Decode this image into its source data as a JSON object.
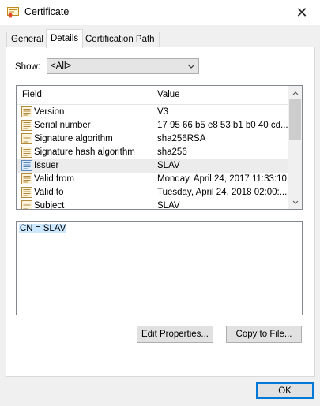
{
  "window": {
    "title": "Certificate",
    "close_glyph": "✕"
  },
  "tabs": [
    {
      "label": "General"
    },
    {
      "label": "Details"
    },
    {
      "label": "Certification Path"
    }
  ],
  "show": {
    "label": "Show:",
    "selected": "<All>"
  },
  "list": {
    "columns": [
      "Field",
      "Value"
    ],
    "rows": [
      {
        "field": "Version",
        "value": "V3"
      },
      {
        "field": "Serial number",
        "value": "17 95 66 b5 e8 53 b1 b0 40 cd..."
      },
      {
        "field": "Signature algorithm",
        "value": "sha256RSA"
      },
      {
        "field": "Signature hash algorithm",
        "value": "sha256"
      },
      {
        "field": "Issuer",
        "value": "SLAV"
      },
      {
        "field": "Valid from",
        "value": "Monday, April 24, 2017 11:33:10"
      },
      {
        "field": "Valid to",
        "value": "Tuesday, April 24, 2018 02:00:..."
      },
      {
        "field": "Subject",
        "value": "SLAV"
      }
    ],
    "selected_index": 4
  },
  "detail": {
    "text": "CN = SLAV"
  },
  "buttons": {
    "edit_properties": "Edit Properties...",
    "copy_to_file": "Copy to File...",
    "ok": "OK"
  }
}
